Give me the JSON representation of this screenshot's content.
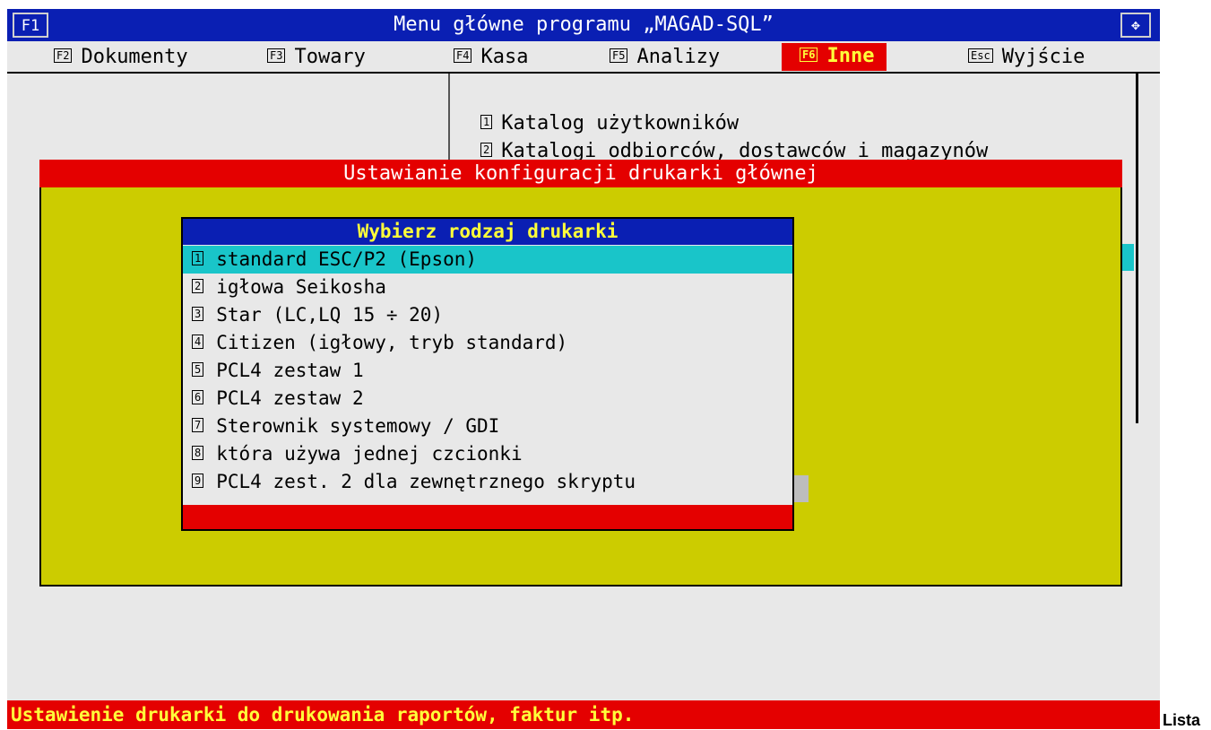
{
  "titlebar": {
    "f1_key": "F1",
    "title": "Menu główne programu „MAGAD-SQL”",
    "move_icon": "move-arrows-icon"
  },
  "menubar": {
    "items": [
      {
        "key": "F2",
        "label": "Dokumenty"
      },
      {
        "key": "F3",
        "label": "Towary"
      },
      {
        "key": "F4",
        "label": "Kasa"
      },
      {
        "key": "F5",
        "label": "Analizy"
      },
      {
        "key": "F6",
        "label": "Inne"
      },
      {
        "key": "Esc",
        "label": "Wyjście"
      }
    ],
    "active_index": 4
  },
  "submenu": {
    "items": [
      {
        "key": "1",
        "label": "Katalog użytkowników"
      },
      {
        "key": "2",
        "label": "Katalogi odbiorców, dostawców i magazynów"
      }
    ]
  },
  "dialog": {
    "title": "Ustawianie konfiguracji drukarki głównej"
  },
  "printer_select": {
    "title": "Wybierz rodzaj drukarki",
    "selected_index": 0,
    "items": [
      {
        "key": "1",
        "label": "standard ESC/P2 (Epson)"
      },
      {
        "key": "2",
        "label": "igłowa Seikosha"
      },
      {
        "key": "3",
        "label": "Star (LC,LQ 15 ÷ 20)"
      },
      {
        "key": "4",
        "label": "Citizen (igłowy, tryb standard)"
      },
      {
        "key": "5",
        "label": "PCL4 zestaw 1"
      },
      {
        "key": "6",
        "label": "PCL4 zestaw 2"
      },
      {
        "key": "7",
        "label": "Sterownik systemowy / GDI"
      },
      {
        "key": "8",
        "label": "która używa jednej czcionki"
      },
      {
        "key": "9",
        "label": "PCL4 zest. 2 dla zewnętrznego skryptu"
      }
    ]
  },
  "statusbar": {
    "text": "Ustawienie drukarki do drukowania raportów, faktur itp."
  },
  "outside_label": "Lista",
  "colors": {
    "title_blue": "#0a1fb3",
    "accent_red": "#e40000",
    "highlight_yellow": "#ffff3a",
    "dialog_olive": "#cccc00",
    "selection_cyan": "#19c5c9",
    "screen_gray": "#e8e8e8"
  }
}
